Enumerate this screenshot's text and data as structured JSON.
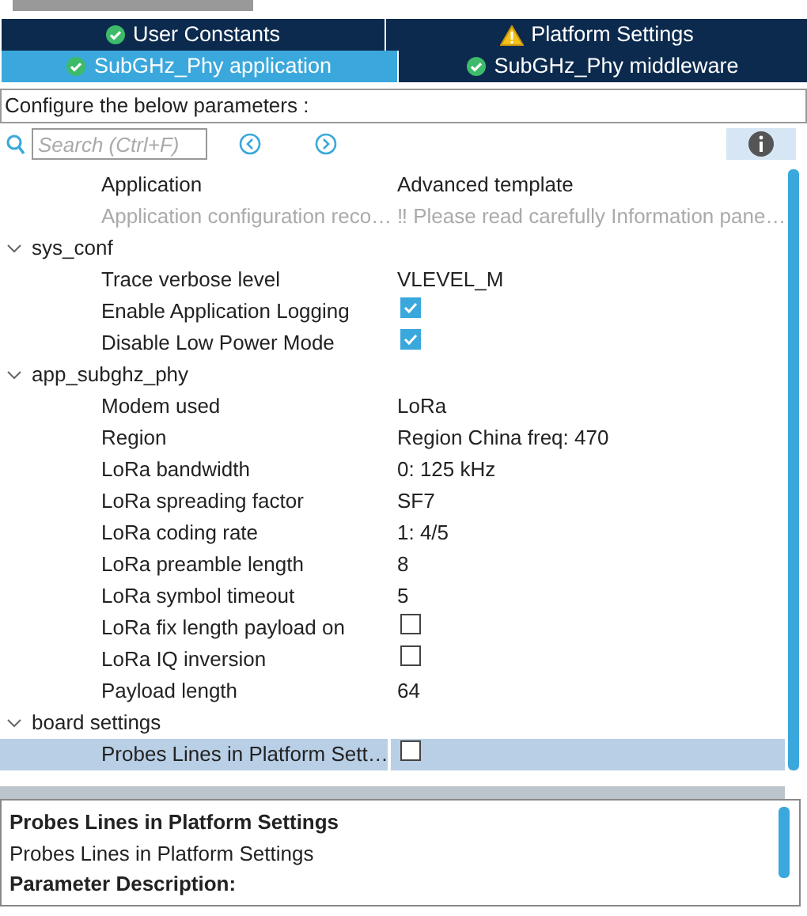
{
  "tabs": [
    [
      {
        "label": "User Constants",
        "kind": "ok",
        "selected": false
      },
      {
        "label": "Platform Settings",
        "kind": "warning",
        "selected": false
      }
    ],
    [
      {
        "label": "SubGHz_Phy application",
        "kind": "ok",
        "selected": true
      },
      {
        "label": "SubGHz_Phy middleware",
        "kind": "ok",
        "selected": false
      }
    ]
  ],
  "configure_label": "Configure the below parameters :",
  "search": {
    "placeholder": "Search (Ctrl+F)"
  },
  "tree": [
    {
      "name": "Application",
      "kind": "text",
      "value": "Advanced template",
      "disabled": false,
      "selected": false
    },
    {
      "name": "Application configuration reco…",
      "kind": "text",
      "value": "‼ Please read carefully Information pane…",
      "disabled": true,
      "selected": false
    },
    {
      "name": "sys_conf",
      "expanded": true,
      "children": [
        {
          "name": "Trace verbose level",
          "kind": "text",
          "value": "VLEVEL_M",
          "disabled": false,
          "selected": false
        },
        {
          "name": "Enable Application Logging",
          "kind": "checkbox",
          "checked": true,
          "disabled": false,
          "selected": false
        },
        {
          "name": "Disable Low Power Mode",
          "kind": "checkbox",
          "checked": true,
          "disabled": false,
          "selected": false
        }
      ]
    },
    {
      "name": "app_subghz_phy",
      "expanded": true,
      "children": [
        {
          "name": "Modem used",
          "kind": "text",
          "value": "LoRa",
          "disabled": false,
          "selected": false
        },
        {
          "name": "Region",
          "kind": "text",
          "value": "Region China freq: 470",
          "disabled": false,
          "selected": false
        },
        {
          "name": "LoRa bandwidth",
          "kind": "text",
          "value": "0: 125 kHz",
          "disabled": false,
          "selected": false
        },
        {
          "name": "LoRa spreading factor",
          "kind": "text",
          "value": "SF7",
          "disabled": false,
          "selected": false
        },
        {
          "name": "LoRa coding rate",
          "kind": "text",
          "value": "1: 4/5",
          "disabled": false,
          "selected": false
        },
        {
          "name": "LoRa preamble length",
          "kind": "text",
          "value": "8",
          "disabled": false,
          "selected": false
        },
        {
          "name": "LoRa symbol timeout",
          "kind": "text",
          "value": "5",
          "disabled": false,
          "selected": false
        },
        {
          "name": "LoRa fix length payload on",
          "kind": "checkbox",
          "checked": false,
          "disabled": false,
          "selected": false
        },
        {
          "name": "LoRa IQ inversion",
          "kind": "checkbox",
          "checked": false,
          "disabled": false,
          "selected": false
        },
        {
          "name": "Payload length",
          "kind": "text",
          "value": "64",
          "disabled": false,
          "selected": false
        }
      ]
    },
    {
      "name": "board settings",
      "expanded": true,
      "children": [
        {
          "name": "Probes Lines in Platform Sett…",
          "kind": "checkbox",
          "checked": false,
          "disabled": false,
          "selected": true
        }
      ]
    }
  ],
  "description": {
    "title": "Probes Lines in Platform Settings",
    "text": "Probes Lines in Platform Settings",
    "heading": "Parameter Description:"
  }
}
